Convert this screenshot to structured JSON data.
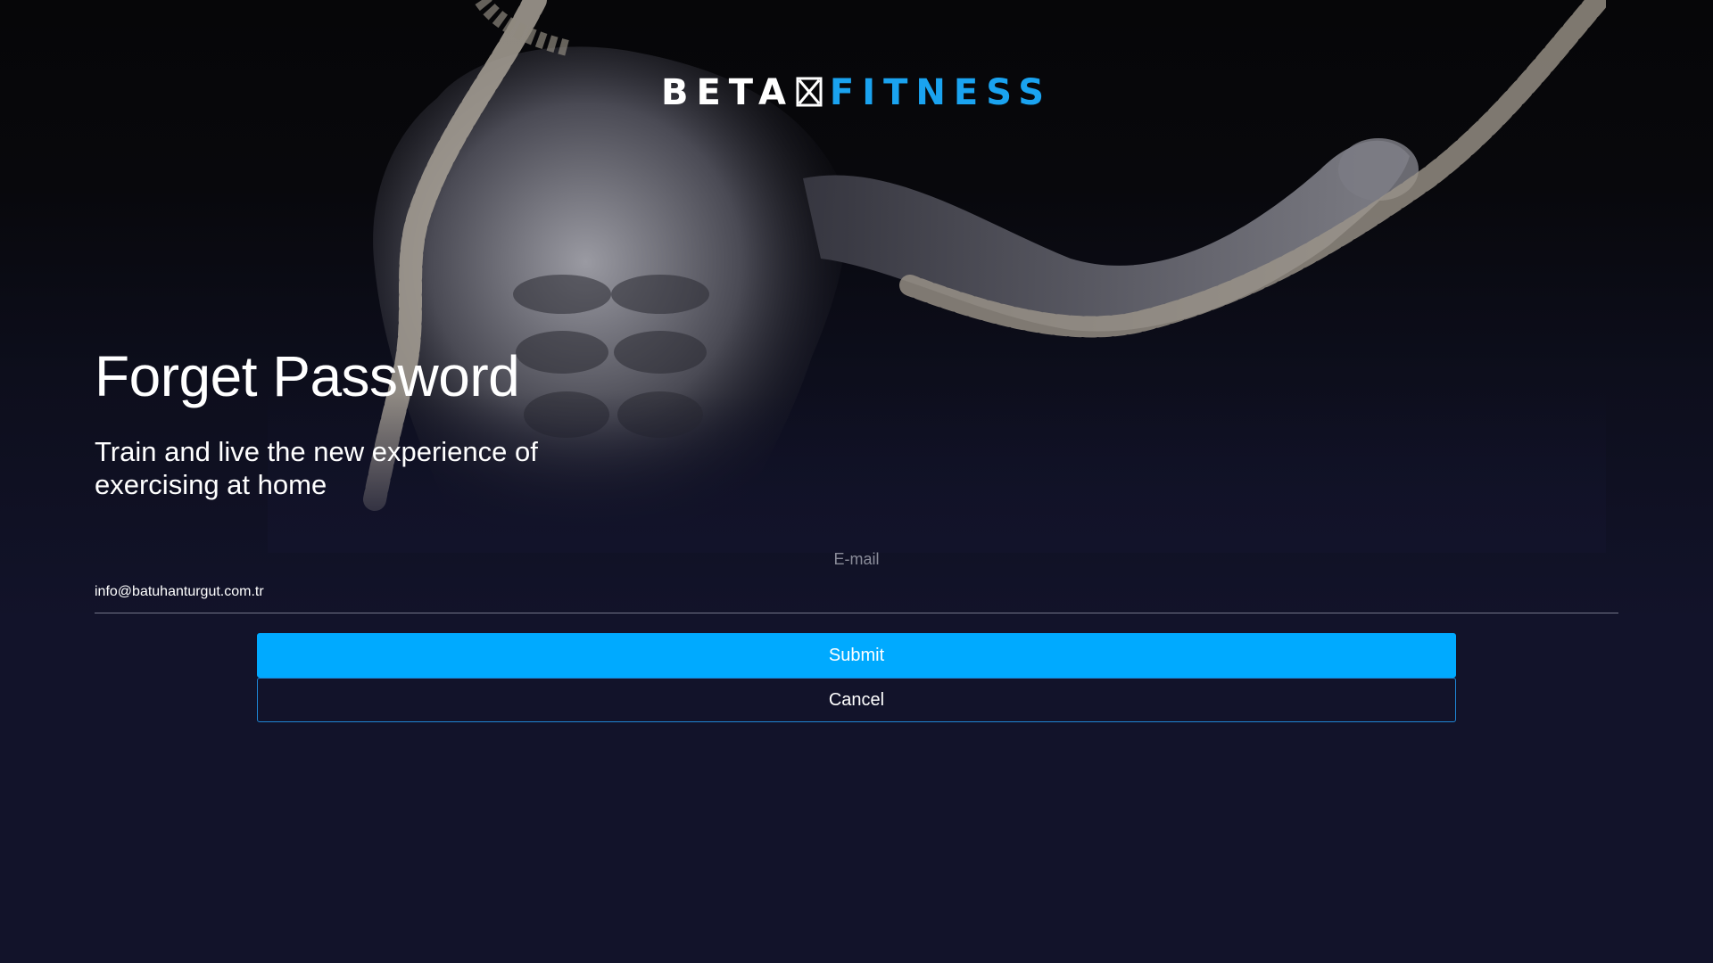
{
  "brand": {
    "logo_left": "BETA",
    "logo_right": "FITNESS",
    "accent_color": "#1aa3f0"
  },
  "hero": {
    "title": "Forget Password",
    "subtitle": "Train and live the new experience of exercising at home"
  },
  "form": {
    "email_label": "E-mail",
    "email_value": "info@batuhanturgut.com.tr",
    "submit_label": "Submit",
    "cancel_label": "Cancel",
    "submit_color": "#00aaff"
  },
  "icons": {
    "logo_mark": "boxed-x-icon"
  }
}
